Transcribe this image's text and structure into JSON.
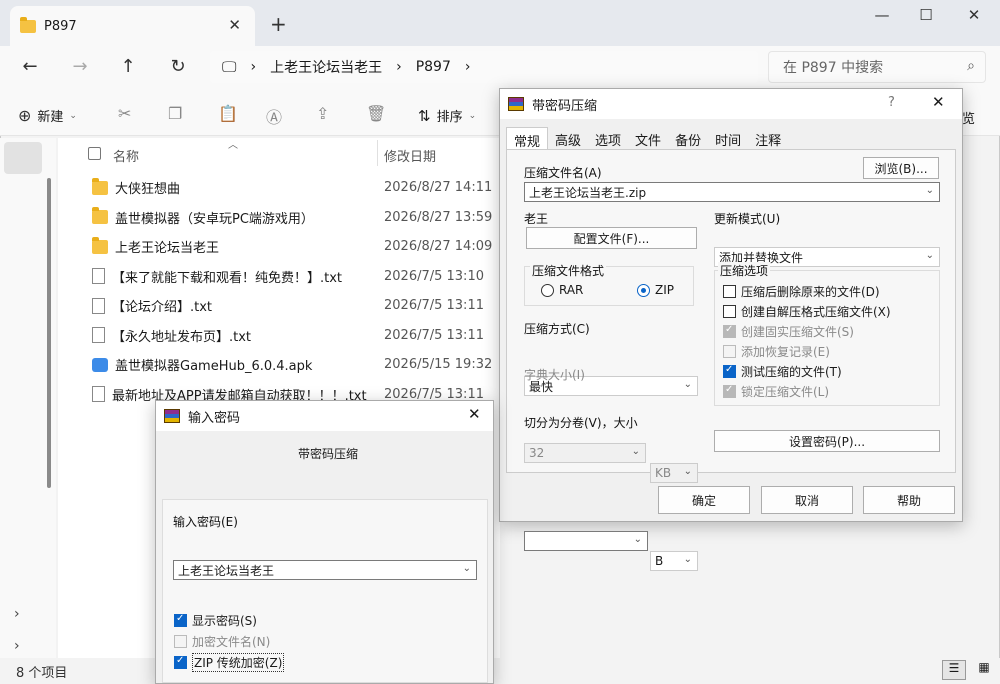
{
  "explorer": {
    "tab_title": "P897",
    "breadcrumb": [
      "上老王论坛当老王",
      "P897"
    ],
    "search_placeholder": "在 P897 中搜索",
    "toolbar": {
      "new_label": "新建",
      "sort_label": "排序",
      "view_label_partial": "览"
    },
    "columns": {
      "name": "名称",
      "modified": "修改日期"
    },
    "files": [
      {
        "name": "大侠狂想曲",
        "date": "2026/8/27 14:11",
        "type": "folder"
      },
      {
        "name": "盖世模拟器（安卓玩PC端游戏用）",
        "date": "2026/8/27 13:59",
        "type": "folder"
      },
      {
        "name": "上老王论坛当老王",
        "date": "2026/8/27 14:09",
        "type": "folder"
      },
      {
        "name": "【来了就能下载和观看！纯免费！】.txt",
        "date": "2026/7/5 13:10",
        "type": "txt"
      },
      {
        "name": "【论坛介绍】.txt",
        "date": "2026/7/5 13:11",
        "type": "txt"
      },
      {
        "name": "【永久地址发布页】.txt",
        "date": "2026/7/5 13:11",
        "type": "txt"
      },
      {
        "name": "盖世模拟器GameHub_6.0.4.apk",
        "date": "2026/5/15 19:32",
        "type": "apk"
      },
      {
        "name": "最新地址及APP请发邮箱自动获取！！！.txt",
        "date": "2026/7/5 13:11",
        "type": "txt"
      }
    ],
    "status": "8 个项目"
  },
  "rar_dialog": {
    "title": "带密码压缩",
    "help_glyph": "?",
    "tabs": [
      "常规",
      "高级",
      "选项",
      "文件",
      "备份",
      "时间",
      "注释"
    ],
    "archive_name_label": "压缩文件名(A)",
    "archive_name": "上老王论坛当老王.zip",
    "browse_label": "浏览(B)...",
    "profile_caption": "老王",
    "profile_button": "配置文件(F)...",
    "update_mode_label": "更新模式(U)",
    "update_mode": "添加并替换文件",
    "format_label": "压缩文件格式",
    "formats": [
      "RAR",
      "ZIP"
    ],
    "method_label": "压缩方式(C)",
    "method": "最快",
    "dict_label": "字典大小(I)",
    "dict_value": "32",
    "dict_unit": "KB",
    "split_label": "切分为分卷(V)，大小",
    "split_unit": "B",
    "options_label": "压缩选项",
    "options": [
      {
        "label": "压缩后删除原来的文件(D)",
        "state": "off"
      },
      {
        "label": "创建自解压格式压缩文件(X)",
        "state": "off"
      },
      {
        "label": "创建固实压缩文件(S)",
        "state": "dison"
      },
      {
        "label": "添加恢复记录(E)",
        "state": "dis"
      },
      {
        "label": "测试压缩的文件(T)",
        "state": "on"
      },
      {
        "label": "锁定压缩文件(L)",
        "state": "dison"
      }
    ],
    "set_password_label": "设置密码(P)...",
    "ok_label": "确定",
    "cancel_label": "取消",
    "help_label": "帮助"
  },
  "password_dialog": {
    "title": "输入密码",
    "subtitle": "带密码压缩",
    "password_label": "输入密码(E)",
    "password_value": "上老王论坛当老王",
    "show_password": "显示密码(S)",
    "encrypt_names": "加密文件名(N)",
    "zip_legacy": "ZIP 传统加密(Z)"
  }
}
